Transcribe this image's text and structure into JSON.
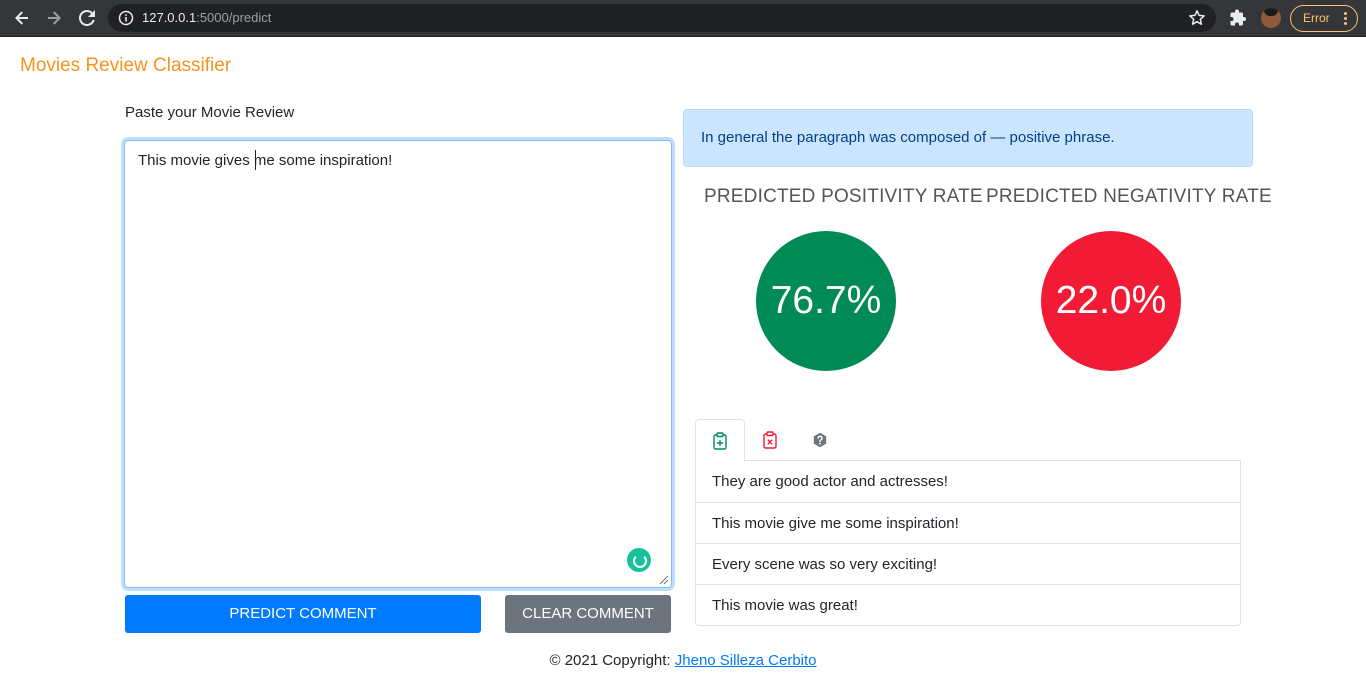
{
  "browser": {
    "url_host": "127.0.0.1",
    "url_rest": ":5000/predict",
    "error_label": "Error"
  },
  "app": {
    "brand": "Movies Review Classifier"
  },
  "input": {
    "label": "Paste your Movie Review",
    "review_text": "This movie gives me some inspiration!"
  },
  "buttons": {
    "predict": "PREDICT COMMENT",
    "clear": "CLEAR COMMENT"
  },
  "result": {
    "summary": "In general the paragraph was composed of — positive phrase.",
    "positivity_label": "PREDICTED POSITIVITY RATE",
    "negativity_label": "PREDICTED NEGATIVITY RATE",
    "positivity_value": "76.7%",
    "negativity_value": "22.0%",
    "positive_color": "#008a55",
    "negative_color": "#f21b36"
  },
  "tabs": [
    {
      "icon": "clipboard-plus-icon",
      "active": true
    },
    {
      "icon": "clipboard-x-icon",
      "active": false
    },
    {
      "icon": "question-icon",
      "active": false
    }
  ],
  "phrases": [
    "They are good actor and actresses!",
    "This movie give me some inspiration!",
    "Every scene was so very exciting!",
    "This movie was great!"
  ],
  "footer": {
    "prefix": "© 2021 Copyright: ",
    "author": "Jheno Silleza Cerbito"
  }
}
